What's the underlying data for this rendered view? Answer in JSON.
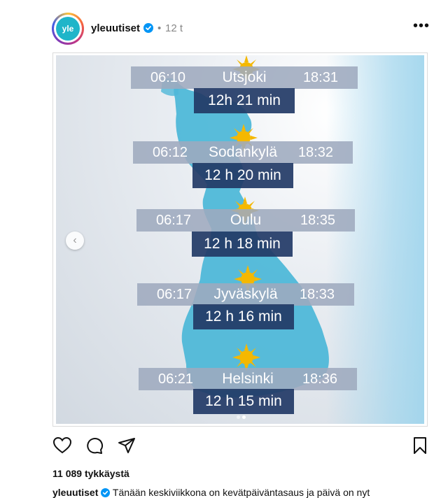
{
  "post": {
    "username": "yleuutiset",
    "avatar_text": "yle",
    "separator": "•",
    "time_ago": "12 t",
    "more_label": "•••"
  },
  "slide": {
    "rows": [
      {
        "sunrise": "06:10",
        "city": "Utsjoki",
        "sunset": "18:31",
        "duration": "12h 21 min"
      },
      {
        "sunrise": "06:12",
        "city": "Sodankylä",
        "sunset": "18:32",
        "duration": "12 h 20 min"
      },
      {
        "sunrise": "06:17",
        "city": "Oulu",
        "sunset": "18:35",
        "duration": "12 h 18 min"
      },
      {
        "sunrise": "06:17",
        "city": "Jyväskylä",
        "sunset": "18:33",
        "duration": "12 h 16 min"
      },
      {
        "sunrise": "06:21",
        "city": "Helsinki",
        "sunset": "18:36",
        "duration": "12 h 15 min"
      }
    ],
    "prev_icon": "chevron-left-icon"
  },
  "actions": {
    "icons": [
      "heart-icon",
      "comment-icon",
      "share-icon",
      "bookmark-icon"
    ]
  },
  "likes_text": "11 089 tykkäystä",
  "caption": {
    "username": "yleuutiset",
    "text": "Tänään keskiviikkona on kevätpäiväntasaus ja päivä on nyt"
  },
  "colors": {
    "map_fill": "#4fb8d8",
    "duration_bg": "#223a66",
    "bar_bg": "#9eaabe",
    "sun": "#f5b800",
    "verified": "#0095f6"
  }
}
